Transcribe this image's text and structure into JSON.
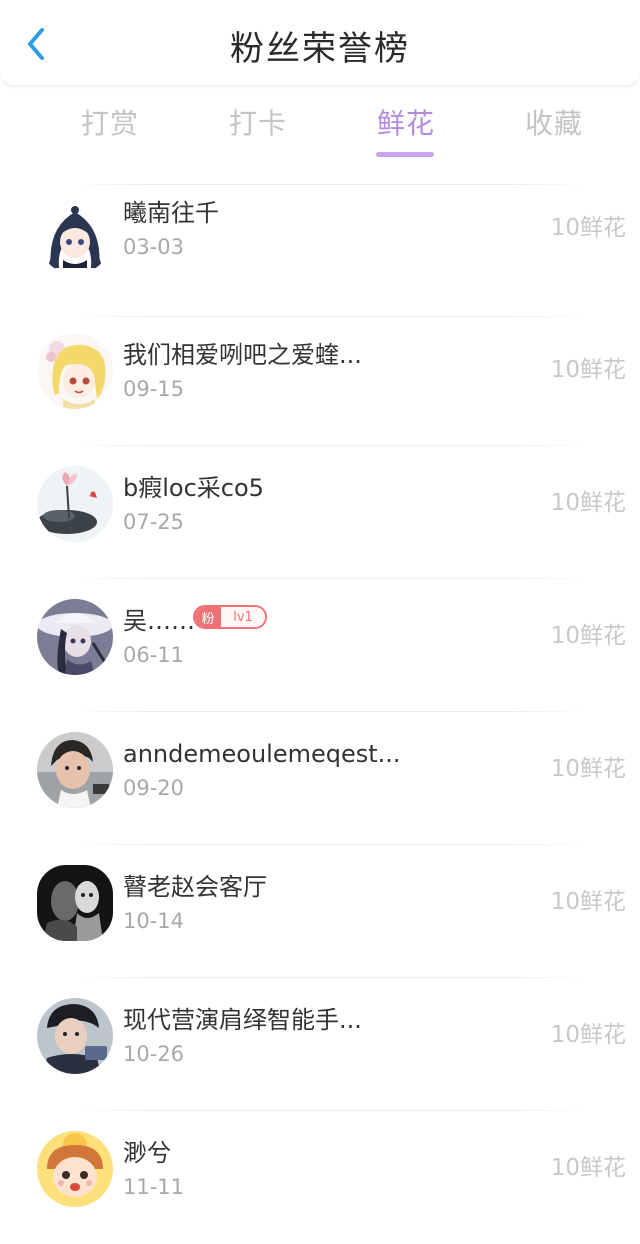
{
  "header": {
    "title": "粉丝荣誉榜"
  },
  "tabs": [
    {
      "label": "打赏",
      "active": false
    },
    {
      "label": "打卡",
      "active": false
    },
    {
      "label": "鲜花",
      "active": true
    },
    {
      "label": "收藏",
      "active": false
    }
  ],
  "colors": {
    "accent": "#b48ade",
    "badge": "#f07276"
  },
  "rows": [
    {
      "name": "曦南往千",
      "date": "03-03",
      "amount": "10鲜花",
      "avatar": "anime-girl-dark-hair"
    },
    {
      "name": "我们相爱咧吧之爱蝰...",
      "date": "09-15",
      "amount": "10鲜花",
      "avatar": "anime-girl-blonde"
    },
    {
      "name": "b瘕loc采co5",
      "date": "07-25",
      "amount": "10鲜花",
      "avatar": "ink-painting-lotus"
    },
    {
      "name": "吴……",
      "date": "06-11",
      "amount": "10鲜花",
      "avatar": "anime-girl-hat",
      "badge": {
        "left": "粉",
        "right": "lv1"
      }
    },
    {
      "name": "anndemeoulemeqest...",
      "date": "09-20",
      "amount": "10鲜花",
      "avatar": "photo-boy"
    },
    {
      "name": "瞽老赵会客厅",
      "date": "10-14",
      "amount": "10鲜花",
      "avatar": "photo-black-white"
    },
    {
      "name": "现代营演肩绎智能手...",
      "date": "10-26",
      "amount": "10鲜花",
      "avatar": "photo-boy-cap"
    },
    {
      "name": "渺兮",
      "date": "11-11",
      "amount": "10鲜花",
      "avatar": "cartoon-child"
    }
  ]
}
